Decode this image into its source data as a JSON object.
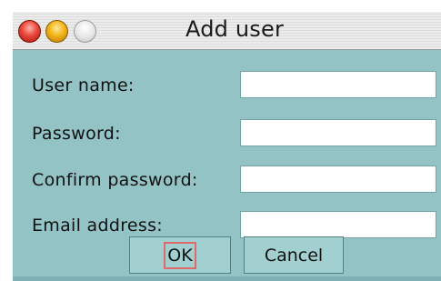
{
  "window": {
    "title": "Add user",
    "controls": {
      "close": "close-icon",
      "minimize": "minimize-icon",
      "zoom": "zoom-icon"
    }
  },
  "form": {
    "fields": [
      {
        "label": "User name:",
        "value": ""
      },
      {
        "label": "Password:",
        "value": ""
      },
      {
        "label": "Confirm password:",
        "value": ""
      },
      {
        "label": "Email address:",
        "value": ""
      }
    ]
  },
  "buttons": {
    "ok_label": "OK",
    "cancel_label": "Cancel"
  },
  "colors": {
    "background": "#93c3c5",
    "button": "#a2d0d1",
    "focus_ring": "#e06a6a"
  }
}
